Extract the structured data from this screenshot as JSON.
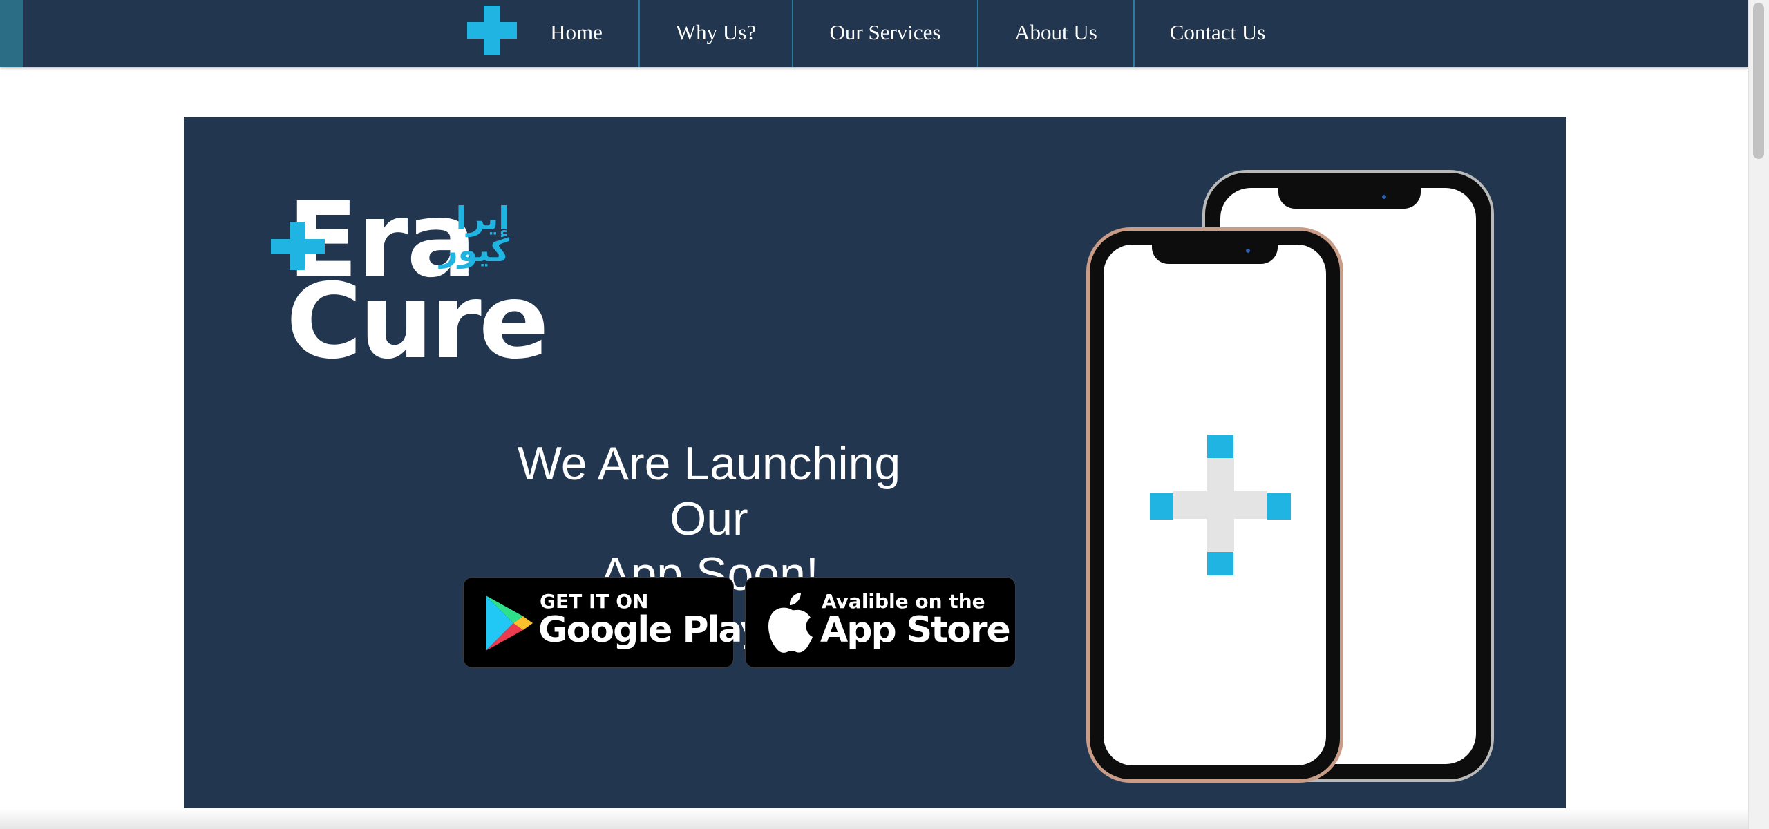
{
  "nav": {
    "items": [
      {
        "label": "Home"
      },
      {
        "label": "Why Us?"
      },
      {
        "label": "Our Services"
      },
      {
        "label": "About Us"
      },
      {
        "label": "Contact Us"
      }
    ]
  },
  "hero": {
    "brand": {
      "latin_line1": "Era",
      "latin_line2": "Cure",
      "arabic_line1": "إيرا",
      "arabic_line2": "كيور"
    },
    "headline_line1": "We Are Launching Our",
    "headline_line2": "App Soon!",
    "google_play": {
      "small": "GET IT ON",
      "big": "Google Play"
    },
    "app_store": {
      "small": "Avalible on the",
      "big": "App Store"
    }
  },
  "colors": {
    "navy": "#22364f",
    "accent": "#1fb4e2",
    "nav_separator": "#2a7ea3"
  },
  "icons": [
    "plus-logo-icon",
    "google-play-icon",
    "apple-icon"
  ]
}
